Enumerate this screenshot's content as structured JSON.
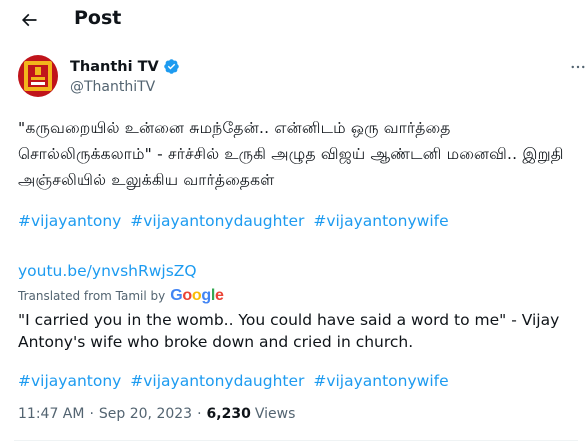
{
  "header": {
    "title": "Post"
  },
  "author": {
    "name": "Thanthi TV",
    "handle": "@ThanthiTV",
    "verified": true
  },
  "tweet": {
    "text_original": "\"கருவறையில் உன்னை சுமந்தேன்.. என்னிடம் ஒரு வார்த்தை சொல்லிருக்கலாம்\" - சர்ச்சில் உருகி அழுத விஜய் ஆண்டனி மனைவி.. இறுதி அஞ்சலியில் உலுக்கிய வார்த்தைகள்",
    "hashtags": [
      "#vijayantony",
      "#vijayantonydaughter",
      "#vijayantonywife"
    ],
    "link": "youtu.be/ynvshRwjsZQ",
    "translated_label": "Translated from Tamil by",
    "translator": "Google",
    "text_translated": "\"I carried you in the womb.. You could have said a word to me\" - Vijay Antony's wife who broke down and cried in church.",
    "hashtags_translated": [
      "#vijayantony",
      "#vijayantonydaughter",
      "#vijayantonywife"
    ]
  },
  "meta": {
    "time": "11:47 AM",
    "separator_1": "·",
    "date": "Sep 20, 2023",
    "separator_2": "·",
    "views_count": "6,230",
    "views_label": "Views"
  },
  "colors": {
    "accent": "#1d9bf0",
    "text_primary": "#0f1419",
    "text_secondary": "#536471",
    "avatar_bg": "#c0141b",
    "avatar_gold": "#f2b51c"
  },
  "icons": {
    "back": "arrow-left-icon",
    "verified": "verified-badge-icon",
    "more": "more-horizontal-icon"
  }
}
